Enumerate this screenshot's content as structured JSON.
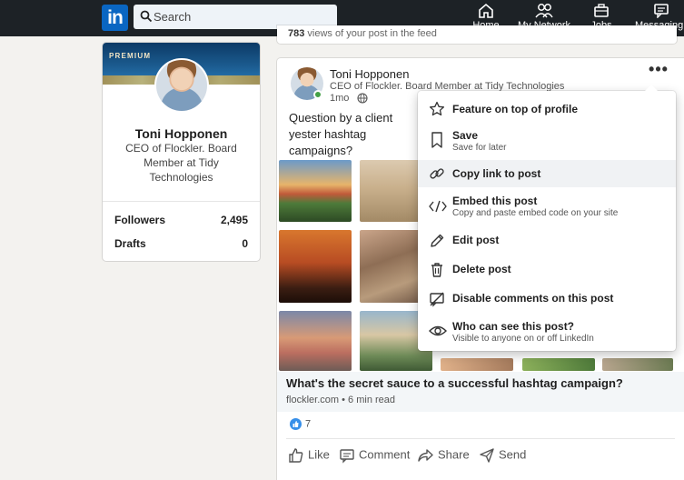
{
  "nav": {
    "logo_text": "in",
    "search_placeholder": "Search",
    "items": [
      {
        "label": "Home",
        "icon": "home-icon"
      },
      {
        "label": "My Network",
        "icon": "people-icon"
      },
      {
        "label": "Jobs",
        "icon": "briefcase-icon"
      },
      {
        "label": "Messaging",
        "icon": "chat-icon"
      }
    ]
  },
  "profile": {
    "badge": "PREMIUM",
    "name": "Toni Hopponen",
    "headline": "CEO of Flockler. Board Member at Tidy Technologies",
    "stats": [
      {
        "label": "Followers",
        "value": "2,495"
      },
      {
        "label": "Drafts",
        "value": "0"
      }
    ]
  },
  "feed_top": {
    "count": "783",
    "text": "views of your post in the feed"
  },
  "post": {
    "author": "Toni Hopponen",
    "author_headline": "CEO of Flockler. Board Member at Tidy Technologies",
    "time": "1mo",
    "more": "•••",
    "text": "Question by a client yester hashtag campaigns?",
    "article_title": "What's the secret sauce to a successful hashtag campaign?",
    "article_source": "flockler.com • 6 min read",
    "reaction_count": "7",
    "actions": [
      "Like",
      "Comment",
      "Share",
      "Send"
    ]
  },
  "menu": {
    "items": [
      {
        "label": "Feature on top of profile",
        "sub": "",
        "icon": "star-icon"
      },
      {
        "label": "Save",
        "sub": "Save for later",
        "icon": "bookmark-icon"
      },
      {
        "label": "Copy link to post",
        "sub": "",
        "icon": "link-icon"
      },
      {
        "label": "Embed this post",
        "sub": "Copy and paste embed code on your site",
        "icon": "code-icon"
      },
      {
        "label": "Edit post",
        "sub": "",
        "icon": "pencil-icon"
      },
      {
        "label": "Delete post",
        "sub": "",
        "icon": "trash-icon"
      },
      {
        "label": "Disable comments on this post",
        "sub": "",
        "icon": "comment-off-icon"
      },
      {
        "label": "Who can see this post?",
        "sub": "Visible to anyone on or off LinkedIn",
        "icon": "eye-icon"
      }
    ]
  },
  "colors": {
    "nav_bg": "#1d2226",
    "brand_blue": "#0a66c2",
    "page_bg": "#f3f2ef",
    "online": "#44a046"
  }
}
